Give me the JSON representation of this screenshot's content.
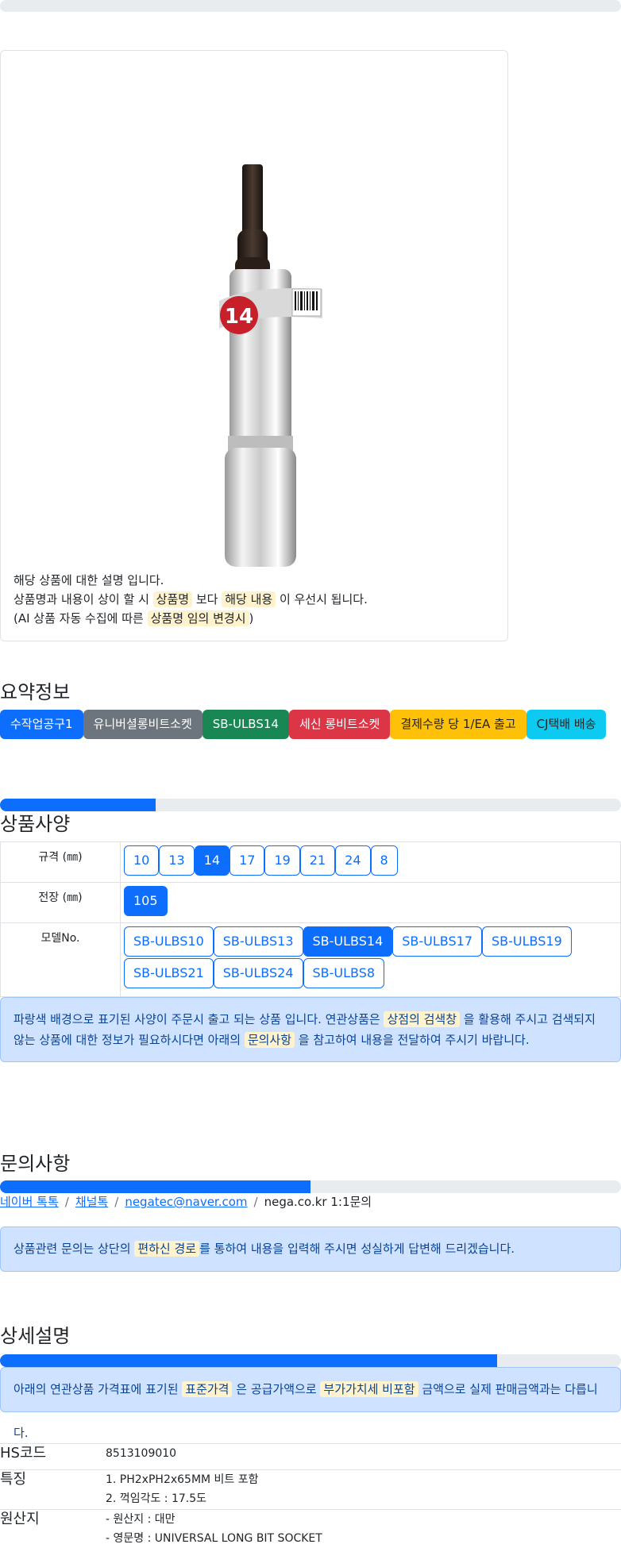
{
  "product": {
    "description_lines": {
      "line1": "해당 상품에 대한 설명 입니다.",
      "line2_prefix": "상품명과 내용이 상이 할 시 ",
      "line2_hl1": "상품명",
      "line2_mid": " 보다 ",
      "line2_hl2": "해당 내용",
      "line2_suffix": " 이 우선시 됩니다.",
      "line3_prefix": "(AI 상품 자동 수집에 따른 ",
      "line3_hl": "상품명 임의 변경시",
      "line3_suffix": ")"
    },
    "image_label": "14"
  },
  "summary": {
    "title": "요약정보",
    "badges": [
      {
        "label": "수작업공구1",
        "color": "#0d6efd",
        "text_color": "#ffffff"
      },
      {
        "label": "유니버셜롱비트소켓",
        "color": "#6c757d",
        "text_color": "#ffffff"
      },
      {
        "label": "SB-ULBS14",
        "color": "#198754",
        "text_color": "#ffffff"
      },
      {
        "label": "세신 롱비트소켓",
        "color": "#dc3545",
        "text_color": "#ffffff"
      },
      {
        "label": "결제수량 당 1/EA 출고",
        "color": "#ffc107",
        "text_color": "#212529"
      },
      {
        "label": "CJ택배 배송",
        "color": "#0dcaf0",
        "text_color": "#212529"
      }
    ]
  },
  "spec": {
    "title": "상품사양",
    "progress": 0.25,
    "rows": [
      {
        "label": "규격 (㎜)",
        "options": [
          "10",
          "13",
          "14",
          "17",
          "19",
          "21",
          "24",
          "8"
        ],
        "selected": "14"
      },
      {
        "label": "전장 (㎜)",
        "options": [
          "105"
        ],
        "selected": "105"
      },
      {
        "label": "모델No.",
        "options": [
          "SB-ULBS10",
          "SB-ULBS13",
          "SB-ULBS14",
          "SB-ULBS17",
          "SB-ULBS19",
          "SB-ULBS21",
          "SB-ULBS24",
          "SB-ULBS8"
        ],
        "selected": "SB-ULBS14"
      }
    ],
    "notice": {
      "p1": "파랑색 배경으로 표기된 사양이 주문시 출고 되는 상품 입니다. 연관상품은 ",
      "hl1": "상점의 검색창",
      "p2": " 을 활용해 주시고 검색되지 않는 상품에 대한 정보가 필요하시다면 아래의 ",
      "hl2": "문의사항",
      "p3": " 을 참고하여 내용을 전달하여 주시기 바랍니다."
    }
  },
  "inquiry": {
    "title": "문의사항",
    "progress": 0.5,
    "links": [
      "네이버 톡톡",
      "채널톡",
      "negatec@naver.com"
    ],
    "plain": "nega.co.kr 1:1문의",
    "notice": {
      "p1": "상품관련 문의는 상단의 ",
      "hl": "편하신 경로",
      "p2": "를 통하여 내용을 입력해 주시면 성실하게 답변해 드리겠습니다."
    }
  },
  "detail": {
    "title": "상세설명",
    "progress": 0.8,
    "notice": {
      "p1": "아래의 연관상품 가격표에 표기된 ",
      "hl1": "표준가격",
      "p2": " 은 공급가액으로 ",
      "hl2": "부가가치세 비포함",
      "p3": " 금액으로 실제 판매금액과는 다릅니다."
    },
    "rows": [
      {
        "key": "HS코드",
        "lines": [
          "8513109010"
        ]
      },
      {
        "key": "특징",
        "lines": [
          "1. PH2xPH2x65MM 비트 포함",
          "2. 꺽임각도 : 17.5도"
        ]
      },
      {
        "key": "원산지",
        "lines": [
          "- 원산지 : 대만",
          "- 영문명 : UNIVERSAL LONG BIT SOCKET"
        ]
      }
    ]
  }
}
